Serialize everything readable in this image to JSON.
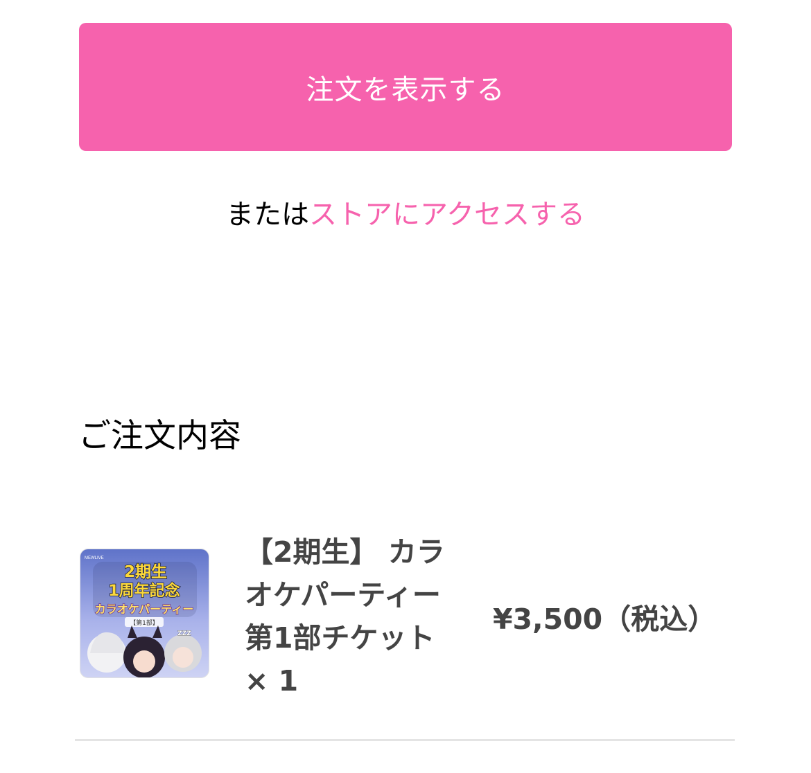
{
  "primary_action": {
    "label": "注文を表示する"
  },
  "store_prompt": {
    "prefix": "または",
    "link_label": "ストアにアクセスする"
  },
  "order_section": {
    "title": "ご注文内容"
  },
  "order_items": [
    {
      "name": "【2期生】 カラオケパーティー第1部チケット",
      "quantity": "× 1",
      "price": "¥3,500（税込）",
      "thumbnail": {
        "brand_text": "MEWLIVE",
        "headline_1": "2期生",
        "headline_2": "1周年記念",
        "headline_3": "カラオケパーティー",
        "headline_4": "【第1部】",
        "badge_text": "ZZZ"
      }
    }
  ],
  "colors": {
    "accent": "#f662ad",
    "text_dark": "#444444",
    "divider": "#e4e4e4"
  }
}
